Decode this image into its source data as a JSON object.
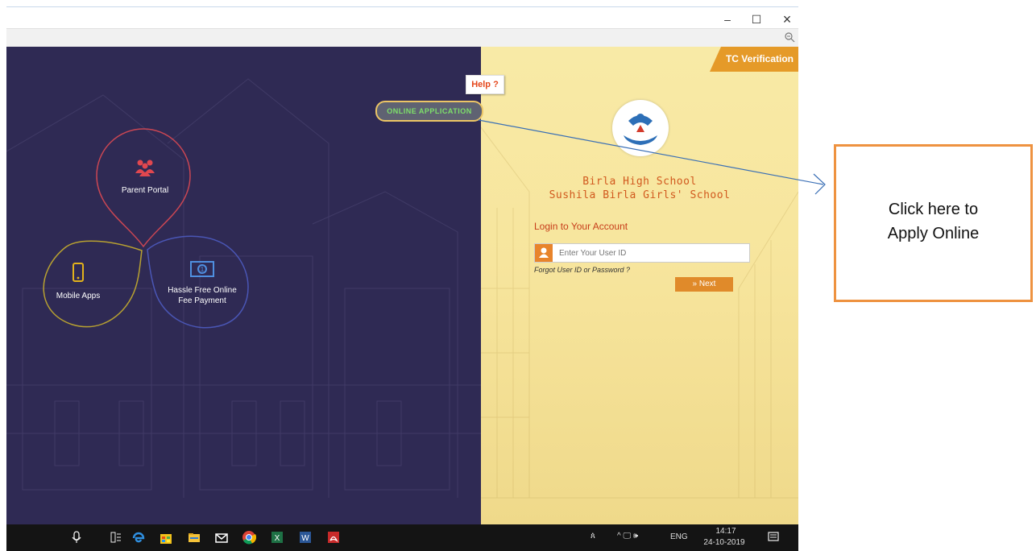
{
  "window": {
    "minimize_glyph": "–",
    "maximize_glyph": "☐",
    "close_glyph": "×"
  },
  "help": {
    "label": "Help ?"
  },
  "online_application": {
    "label": "ONLINE APPLICATION"
  },
  "tc_verification": {
    "label": "TC Verification"
  },
  "portals": [
    {
      "label": "Parent Portal",
      "color": "#c94653",
      "icon": "parents-icon"
    },
    {
      "label": "Mobile Apps",
      "color": "#b8a131",
      "icon": "mobile-phone-icon"
    },
    {
      "label_line1": "Hassle Free Online",
      "label_line2": "Fee Payment",
      "color": "#4a56b5",
      "icon": "banknote-icon"
    }
  ],
  "school": {
    "name1": "Birla High School",
    "name2": "Sushila Birla Girls' School"
  },
  "login": {
    "heading": "Login to Your Account",
    "user_placeholder": "Enter Your User ID",
    "forgot_label": "Forgot User ID or Password ?",
    "next_label": "» Next"
  },
  "taskbar": {
    "icons": [
      "microphone-icon",
      "task-view-icon",
      "edge-icon",
      "store-icon",
      "file-explorer-icon",
      "mail-icon",
      "chrome-icon",
      "excel-icon",
      "word-icon",
      "acrobat-icon"
    ],
    "tray_people": "ጰ",
    "tray_glyphs": "^ 🖵 🕪",
    "language": "ENG",
    "time": "14:17",
    "date": "24-10-2019"
  },
  "callout": {
    "line1": "Click here to",
    "line2": "Apply Online"
  },
  "colors": {
    "accent_orange": "#e8842b",
    "left_bg": "#2f2a54",
    "callout_border": "#ee9240"
  }
}
